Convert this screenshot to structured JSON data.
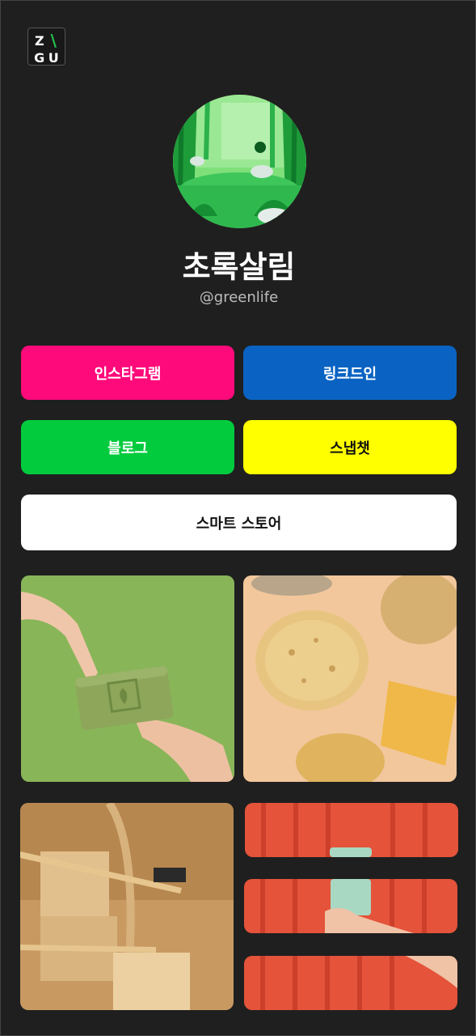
{
  "logo": {
    "letters": [
      "Z",
      "G",
      "U"
    ]
  },
  "profile": {
    "name": "초록살림",
    "handle": "@greenlife"
  },
  "links": {
    "instagram": "인스타그램",
    "linkedin": "링크드인",
    "blog": "블로그",
    "snapchat": "스냅챗",
    "smartstore": "스마트 스토어"
  },
  "colors": {
    "background": "#1f1f1f",
    "instagram": "#ff0a7a",
    "linkedin": "#0a63c3",
    "blog": "#02cb3d",
    "snapchat": "#ffff00",
    "smartstore": "#ffffff",
    "logo_accent": "#23c44b"
  },
  "gallery": [
    "soap-photo",
    "sponge-photo",
    "bamboo-toothbrush-photo",
    "reusable-cup-photo"
  ]
}
